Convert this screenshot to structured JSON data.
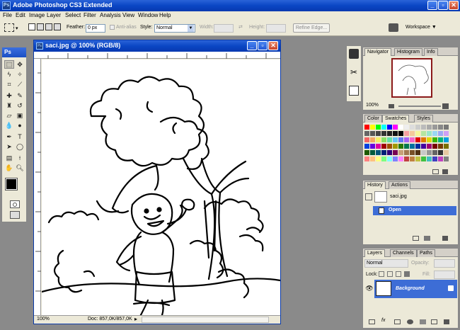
{
  "app": {
    "title": "Adobe Photoshop CS3 Extended"
  },
  "menu": [
    "File",
    "Edit",
    "Image",
    "Layer",
    "Select",
    "Filter",
    "Analysis",
    "View",
    "Window",
    "Help"
  ],
  "options": {
    "feather_label": "Feather:",
    "feather_value": "0 px",
    "antialias_label": "Anti-alias",
    "style_label": "Style:",
    "style_value": "Normal",
    "width_label": "Width:",
    "height_label": "Height:",
    "refine_label": "Refine Edge...",
    "workspace_label": "Workspace ▼"
  },
  "toolbox": {
    "header": "Ps"
  },
  "document": {
    "title": "saci.jpg @ 100% (RGB/8)",
    "zoom": "100%",
    "doc_info": "Doc: 857,0K/857,0K"
  },
  "navigator": {
    "tabs": [
      "Navigator",
      "Histogram",
      "Info"
    ],
    "zoom": "100%"
  },
  "color_panel": {
    "tabs": [
      "Color",
      "Swatches",
      "Styles"
    ]
  },
  "history": {
    "tabs": [
      "History",
      "Actions"
    ],
    "snapshot": "saci.jpg",
    "state": "Open"
  },
  "layers": {
    "tabs": [
      "Layers",
      "Channels",
      "Paths"
    ],
    "blend_mode": "Normal",
    "opacity_label": "Opacity:",
    "lock_label": "Lock:",
    "fill_label": "Fill:",
    "layer_name": "Background"
  },
  "colors": {
    "titlebar": "#0a46c4",
    "panel_bg": "#ece9d8",
    "selection": "#3d6dd6"
  }
}
